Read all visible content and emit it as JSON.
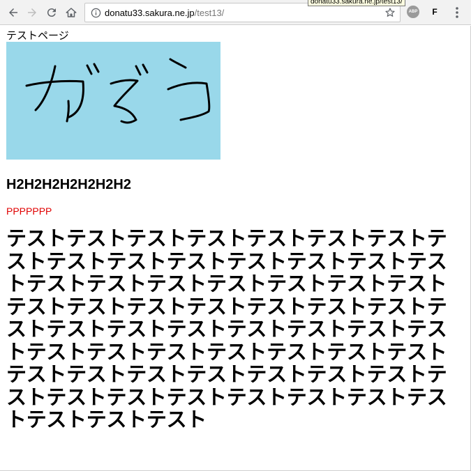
{
  "browser": {
    "url_host": "donatu33.sakura.ne.jp",
    "url_path": "/test13/",
    "tooltip": "donatu33.sakura.ne.jp/test13/",
    "extension_abp": "ABP",
    "extension_f": "F"
  },
  "page": {
    "title_text": "テストページ",
    "image_alt_drawn_text": "がぞう",
    "h2_text": "H2H2H2H2H2H2H2",
    "p_text": "PPPPPPP",
    "big_text": "テストテストテストテストテストテストテストテストテストテストテストテストテストテストテストテストテストテストテストテストテストテストテストテストテストテストテストテストテストテストテストテストテストテストテストテストテストテストテストテストテストテストテストテストテストテストテストテストテストテストテストテストテストテストテストテストテストテストテストテストテストテスト"
  },
  "colors": {
    "image_bg": "#99d8ea",
    "p_color": "#e00000"
  }
}
